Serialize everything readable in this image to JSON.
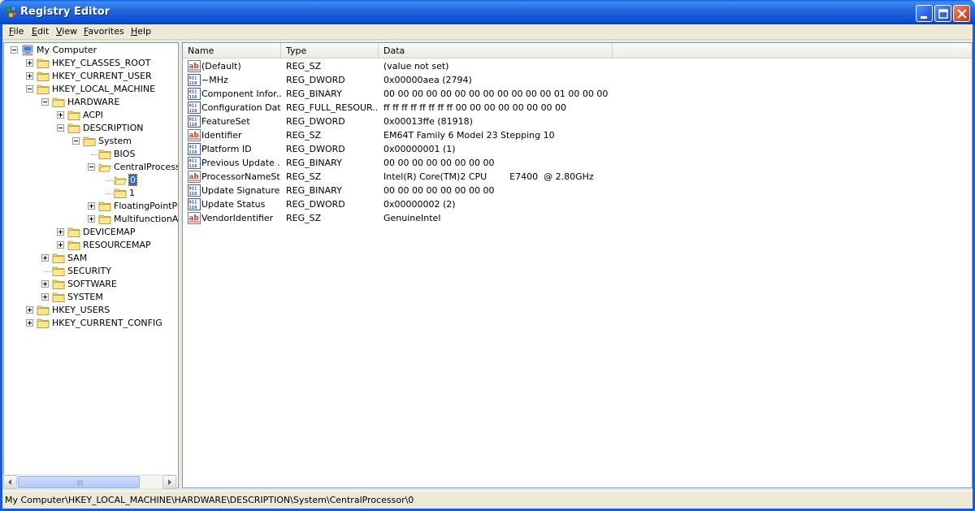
{
  "window": {
    "title": "Registry Editor"
  },
  "menu": [
    {
      "label": "File"
    },
    {
      "label": "Edit"
    },
    {
      "label": "View"
    },
    {
      "label": "Favorites"
    },
    {
      "label": "Help"
    }
  ],
  "tree": [
    {
      "label": "My Computer",
      "level": 0,
      "expander": "minus",
      "icon": "computer-icon"
    },
    {
      "label": "HKEY_CLASSES_ROOT",
      "level": 1,
      "expander": "plus",
      "icon": "folder-icon"
    },
    {
      "label": "HKEY_CURRENT_USER",
      "level": 1,
      "expander": "plus",
      "icon": "folder-icon"
    },
    {
      "label": "HKEY_LOCAL_MACHINE",
      "level": 1,
      "expander": "minus",
      "icon": "folder-icon"
    },
    {
      "label": "HARDWARE",
      "level": 2,
      "expander": "minus",
      "icon": "folder-icon"
    },
    {
      "label": "ACPI",
      "level": 3,
      "expander": "plus",
      "icon": "folder-icon"
    },
    {
      "label": "DESCRIPTION",
      "level": 3,
      "expander": "minus",
      "icon": "folder-icon"
    },
    {
      "label": "System",
      "level": 4,
      "expander": "minus",
      "icon": "folder-icon"
    },
    {
      "label": "BIOS",
      "level": 5,
      "expander": "none",
      "icon": "folder-icon"
    },
    {
      "label": "CentralProcessor",
      "level": 5,
      "expander": "minus",
      "icon": "folder-open-icon"
    },
    {
      "label": "0",
      "level": 6,
      "expander": "none",
      "icon": "folder-open-icon",
      "selected": true
    },
    {
      "label": "1",
      "level": 6,
      "expander": "none",
      "icon": "folder-icon"
    },
    {
      "label": "FloatingPointProcessor",
      "level": 5,
      "expander": "plus",
      "icon": "folder-icon"
    },
    {
      "label": "MultifunctionAdapter",
      "level": 5,
      "expander": "plus",
      "icon": "folder-icon"
    },
    {
      "label": "DEVICEMAP",
      "level": 3,
      "expander": "plus",
      "icon": "folder-icon"
    },
    {
      "label": "RESOURCEMAP",
      "level": 3,
      "expander": "plus",
      "icon": "folder-icon"
    },
    {
      "label": "SAM",
      "level": 2,
      "expander": "plus",
      "icon": "folder-icon"
    },
    {
      "label": "SECURITY",
      "level": 2,
      "expander": "none",
      "icon": "folder-icon"
    },
    {
      "label": "SOFTWARE",
      "level": 2,
      "expander": "plus",
      "icon": "folder-icon"
    },
    {
      "label": "SYSTEM",
      "level": 2,
      "expander": "plus",
      "icon": "folder-icon"
    },
    {
      "label": "HKEY_USERS",
      "level": 1,
      "expander": "plus",
      "icon": "folder-icon"
    },
    {
      "label": "HKEY_CURRENT_CONFIG",
      "level": 1,
      "expander": "plus",
      "icon": "folder-icon"
    }
  ],
  "list": {
    "columns": [
      "Name",
      "Type",
      "Data"
    ],
    "rows": [
      {
        "name": "(Default)",
        "type": "REG_SZ",
        "data": "(value not set)",
        "icon": "string-value-icon"
      },
      {
        "name": "~MHz",
        "type": "REG_DWORD",
        "data": "0x00000aea (2794)",
        "icon": "binary-value-icon"
      },
      {
        "name": "Component Infor...",
        "type": "REG_BINARY",
        "data": "00 00 00 00 00 00 00 00 00 00 00 00 01 00 00 00",
        "icon": "binary-value-icon"
      },
      {
        "name": "Configuration Data",
        "type": "REG_FULL_RESOUR...",
        "data": "ff ff ff ff ff ff ff ff 00 00 00 00 00 00 00 00",
        "icon": "binary-value-icon"
      },
      {
        "name": "FeatureSet",
        "type": "REG_DWORD",
        "data": "0x00013ffe (81918)",
        "icon": "binary-value-icon"
      },
      {
        "name": "Identifier",
        "type": "REG_SZ",
        "data": "EM64T Family 6 Model 23 Stepping 10",
        "icon": "string-value-icon"
      },
      {
        "name": "Platform ID",
        "type": "REG_DWORD",
        "data": "0x00000001 (1)",
        "icon": "binary-value-icon"
      },
      {
        "name": "Previous Update ...",
        "type": "REG_BINARY",
        "data": "00 00 00 00 00 00 00 00",
        "icon": "binary-value-icon"
      },
      {
        "name": "ProcessorNameSt...",
        "type": "REG_SZ",
        "data": "Intel(R) Core(TM)2 CPU        E7400  @ 2.80GHz",
        "icon": "string-value-icon"
      },
      {
        "name": "Update Signature",
        "type": "REG_BINARY",
        "data": "00 00 00 00 00 00 00 00",
        "icon": "binary-value-icon"
      },
      {
        "name": "Update Status",
        "type": "REG_DWORD",
        "data": "0x00000002 (2)",
        "icon": "binary-value-icon"
      },
      {
        "name": "VendorIdentifier",
        "type": "REG_SZ",
        "data": "GenuineIntel",
        "icon": "string-value-icon"
      }
    ]
  },
  "status": {
    "path": "My Computer\\HKEY_LOCAL_MACHINE\\HARDWARE\\DESCRIPTION\\System\\CentralProcessor\\0"
  }
}
